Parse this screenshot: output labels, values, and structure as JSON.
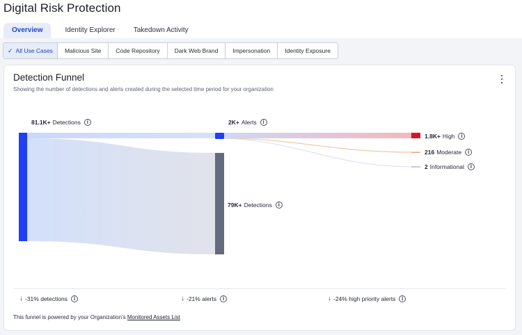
{
  "page": {
    "title": "Digital Risk Protection"
  },
  "tabs": [
    {
      "label": "Overview",
      "active": true
    },
    {
      "label": "Identity Explorer",
      "active": false
    },
    {
      "label": "Takedown Activity",
      "active": false
    }
  ],
  "filters": [
    {
      "label": "All Use Cases",
      "active": true
    },
    {
      "label": "Malicious Site",
      "active": false
    },
    {
      "label": "Code Repository",
      "active": false
    },
    {
      "label": "Dark Web Brand",
      "active": false
    },
    {
      "label": "Impersonation",
      "active": false
    },
    {
      "label": "Identity Exposure",
      "active": false
    }
  ],
  "card": {
    "title": "Detection Funnel",
    "subtitle": "Showing the number of detections and alerts created during the selected time period for your organization"
  },
  "funnel": {
    "total": {
      "value": "81.1K+",
      "label": "Detections"
    },
    "alerts": {
      "value": "2K+",
      "label": "Alerts"
    },
    "non_alert_detections": {
      "value": "79K+",
      "label": "Detections"
    },
    "severities": [
      {
        "value": "1.8K+",
        "label": "High",
        "color": "#d0172a"
      },
      {
        "value": "216",
        "label": "Moderate",
        "color": "#f0a067"
      },
      {
        "value": "2",
        "label": "Informational",
        "color": "#8b93c9"
      }
    ],
    "colors": {
      "detections": "#1e3ff2",
      "alerts": "#1e3ff2",
      "other_detections": "#636b7d"
    }
  },
  "stats": [
    {
      "value": "-31%",
      "label": "detections"
    },
    {
      "value": "-21%",
      "label": "alerts"
    },
    {
      "value": "-24%",
      "label": "high priority alerts"
    }
  ],
  "footer": {
    "text": "This funnel is powered by your Organization's",
    "link": "Monitored Assets List"
  }
}
